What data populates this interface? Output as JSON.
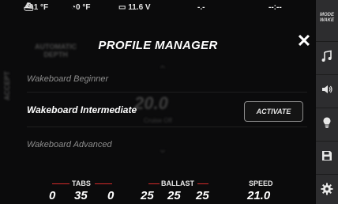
{
  "status_bar": {
    "temp1": "1 °F",
    "temp2": "0 °F",
    "voltage": "11.6 V",
    "field4": "-.-",
    "field5": "--:--"
  },
  "background": {
    "top_left_label": "AUTOMATIC\nDEPTH",
    "side_label": "ACCEPT",
    "center_value": "20.0",
    "center_sub": "Cruise Off"
  },
  "modal": {
    "title": "PROFILE MANAGER",
    "profiles": [
      {
        "label": "Wakeboard Beginner",
        "selected": false
      },
      {
        "label": "Wakeboard Intermediate",
        "selected": true
      },
      {
        "label": "Wakeboard Advanced",
        "selected": false
      }
    ],
    "activate_label": "ACTIVATE"
  },
  "bottom_bar": {
    "tabs_title": "TABS",
    "tabs_values": [
      "0",
      "35",
      "0"
    ],
    "ballast_title": "BALLAST",
    "ballast_values": [
      "25",
      "25",
      "25"
    ],
    "speed_title": "SPEED",
    "speed_value": "21.0"
  },
  "side_menu": {
    "mode_label": "MODE\nWAKE",
    "items": [
      {
        "icon": "music-note-icon"
      },
      {
        "icon": "speaker-icon"
      },
      {
        "icon": "lightbulb-icon"
      },
      {
        "icon": "save-icon"
      },
      {
        "icon": "gear-icon"
      }
    ]
  },
  "colors": {
    "accent_red": "#d42a2a",
    "panel": "#2d2d2f",
    "background": "#0b0b0c"
  }
}
